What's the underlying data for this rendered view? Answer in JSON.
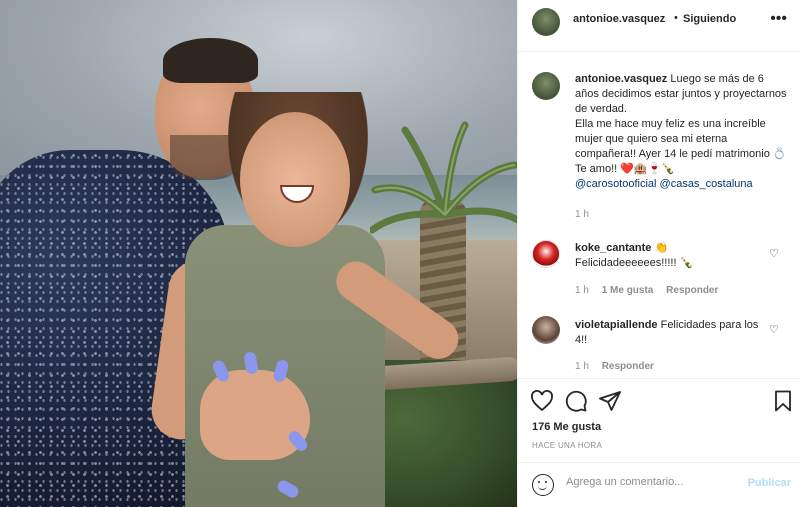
{
  "post": {
    "author": "antonioe.vasquez",
    "separator": "•",
    "follow_status": "Siguiendo",
    "more_icon": "ellipsis-icon"
  },
  "caption": {
    "username": "antonioe.vasquez",
    "text_part1": "Luego se más de 6 años decidimos estar juntos y proyectarnos de verdad.",
    "text_part2": "Ella me hace muy feliz es una increíble mujer que quiero sea mi eterna compañera!! Ayer 14 le pedí matrimonio 💍Te amo!! ❤️🏨🍷🍾",
    "mention1": "@carosotooficial",
    "mention2": "@casas_costaluna",
    "time": "1 h"
  },
  "comments": [
    {
      "username": "koke_cantante",
      "text": "👏 Felicidadeeeeees!!!!! 🍾",
      "time": "1 h",
      "likes": "1 Me gusta",
      "reply": "Responder"
    },
    {
      "username": "violetapiallende",
      "text": "Felicidades para los 4!!",
      "time": "1 h",
      "reply": "Responder"
    }
  ],
  "actions": {
    "like_icon": "heart-icon",
    "comment_icon": "comment-icon",
    "share_icon": "share-icon",
    "save_icon": "bookmark-icon",
    "likes": "176 Me gusta",
    "posted": "HACE UNA HORA"
  },
  "comment_box": {
    "placeholder": "Agrega un comentario...",
    "publish": "Publicar",
    "emoji_icon": "emoji-icon"
  },
  "colors": {
    "link": "#00376b",
    "muted": "#8e8e8e",
    "publish_disabled": "#b2dffc",
    "border": "#efefef"
  }
}
